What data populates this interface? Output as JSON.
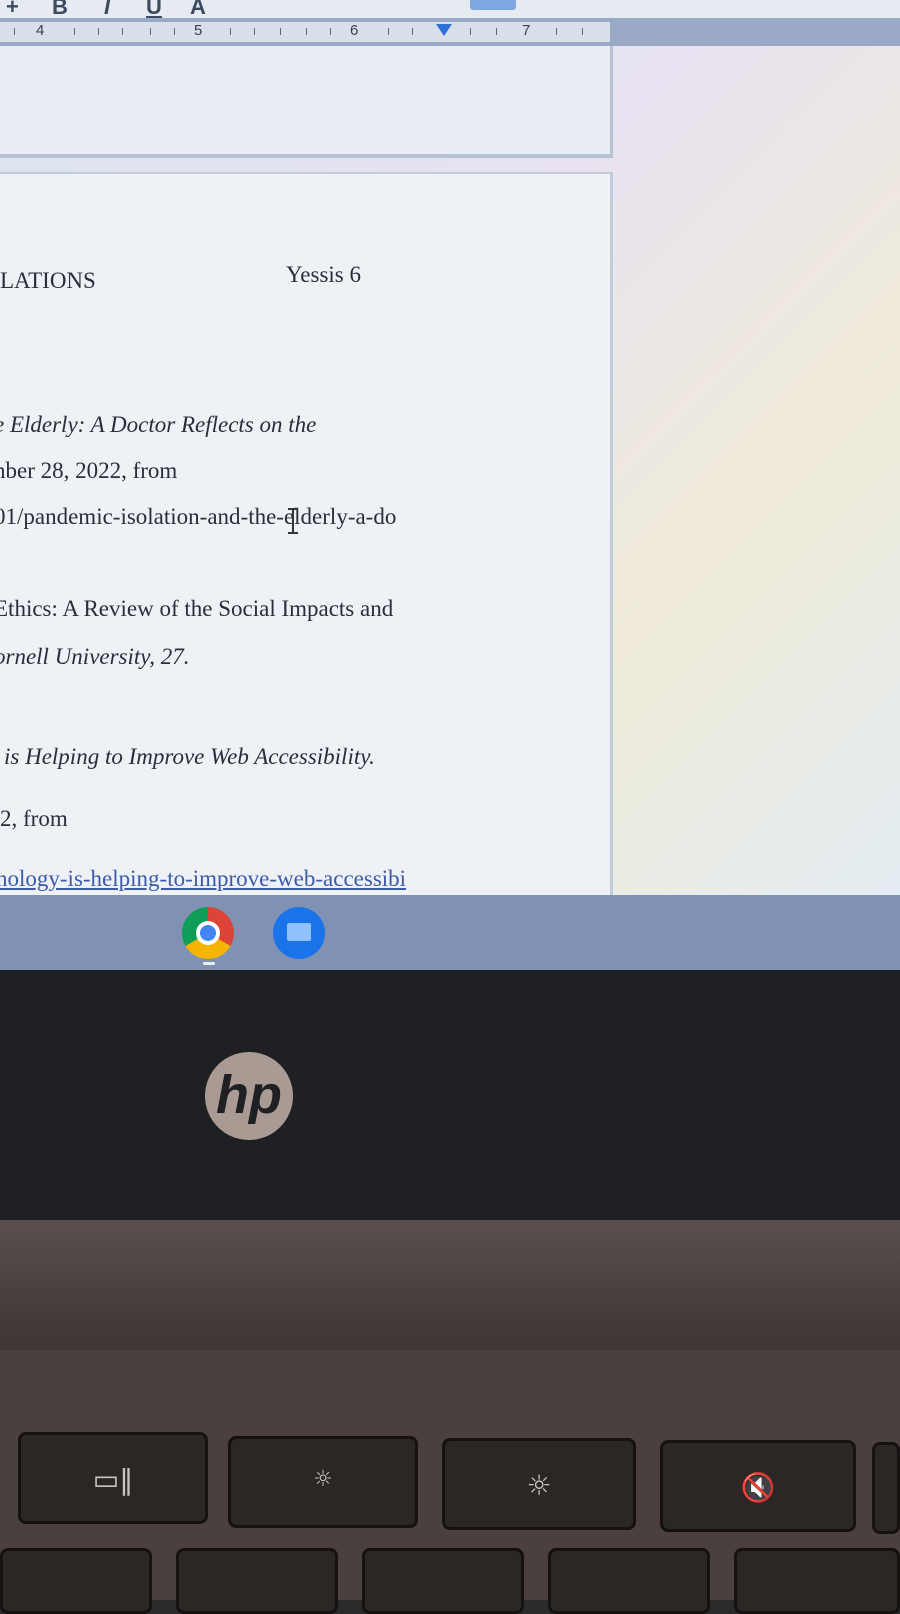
{
  "toolbar": {
    "plus_icon": "+",
    "bold_label": "B",
    "italic_label": "I",
    "underline_label": "U",
    "text_color_label": "A"
  },
  "ruler": {
    "marks": [
      "4",
      "5",
      "6",
      "7"
    ]
  },
  "document": {
    "header_left": "LATIONS",
    "header_right": "Yessis 6",
    "lines": [
      "e Elderly: A Doctor Reflects on the",
      "nber 28, 2022, from",
      "01/pandemic-isolation-and-the-elderly-a-do",
      "Ethics: A Review of the Social Impacts and",
      "ornell University, 27.",
      "is Helping to Improve Web Accessibility.",
      "2, from",
      "nology-is-helping-to-improve-web-accessibi"
    ]
  },
  "shelf": {
    "apps": [
      "chrome-icon",
      "files-icon"
    ]
  },
  "laptop": {
    "logo": "hp",
    "keys": [
      "overview-icon",
      "brightness-down-icon",
      "brightness-up-icon",
      "mute-icon"
    ],
    "key_glyphs": [
      "▭‖",
      "☼",
      "☼",
      "🔇"
    ]
  },
  "colors": {
    "link": "#3b5aa8",
    "ruler_indent": "#2f6fd8",
    "shelf": "#8092b3"
  }
}
